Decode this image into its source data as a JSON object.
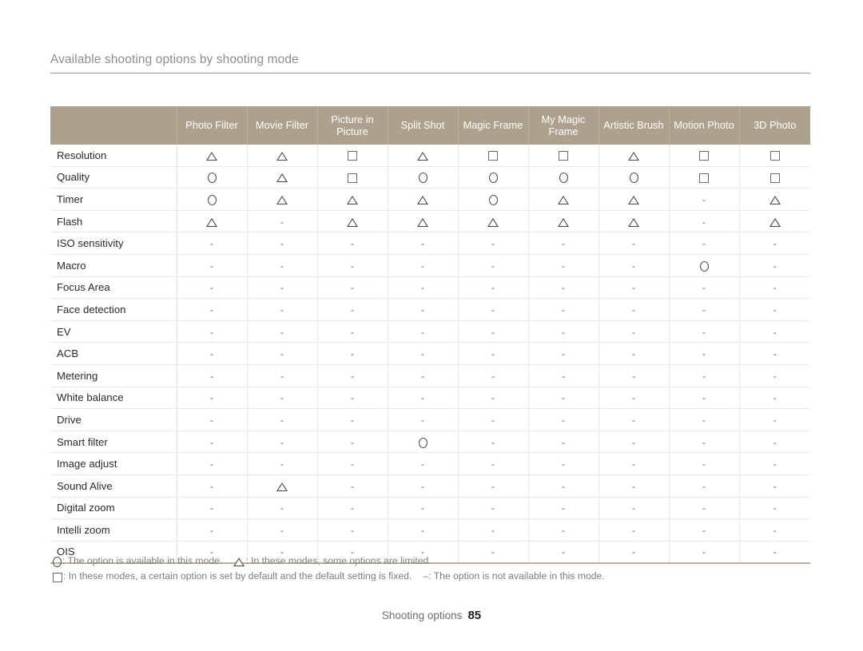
{
  "header": {
    "title": "Available shooting options by shooting mode"
  },
  "table": {
    "row_header_label": "",
    "columns": [
      "Photo Filter",
      "Movie Filter",
      "Picture in Picture",
      "Split Shot",
      "Magic Frame",
      "My Magic Frame",
      "Artistic Brush",
      "Motion Photo",
      "3D Photo"
    ],
    "rows": [
      {
        "name": "Resolution",
        "values": [
          "triangle",
          "triangle",
          "square",
          "triangle",
          "square",
          "square",
          "triangle",
          "square",
          "square"
        ]
      },
      {
        "name": "Quality",
        "values": [
          "circle",
          "triangle",
          "square",
          "circle",
          "circle",
          "circle",
          "circle",
          "square",
          "square"
        ]
      },
      {
        "name": "Timer",
        "values": [
          "circle",
          "triangle",
          "triangle",
          "triangle",
          "circle",
          "triangle",
          "triangle",
          "dash",
          "triangle"
        ]
      },
      {
        "name": "Flash",
        "values": [
          "triangle",
          "dash",
          "triangle",
          "triangle",
          "triangle",
          "triangle",
          "triangle",
          "dash",
          "triangle"
        ]
      },
      {
        "name": "ISO sensitivity",
        "values": [
          "dash",
          "dash",
          "dash",
          "dash",
          "dash",
          "dash",
          "dash",
          "dash",
          "dash"
        ]
      },
      {
        "name": "Macro",
        "values": [
          "dash",
          "dash",
          "dash",
          "dash",
          "dash",
          "dash",
          "dash",
          "circle",
          "dash"
        ]
      },
      {
        "name": "Focus Area",
        "values": [
          "dash",
          "dash",
          "dash",
          "dash",
          "dash",
          "dash",
          "dash",
          "dash",
          "dash"
        ]
      },
      {
        "name": "Face detection",
        "values": [
          "dash",
          "dash",
          "dash",
          "dash",
          "dash",
          "dash",
          "dash",
          "dash",
          "dash"
        ]
      },
      {
        "name": "EV",
        "values": [
          "dash",
          "dash",
          "dash",
          "dash",
          "dash",
          "dash",
          "dash",
          "dash",
          "dash"
        ]
      },
      {
        "name": "ACB",
        "values": [
          "dash",
          "dash",
          "dash",
          "dash",
          "dash",
          "dash",
          "dash",
          "dash",
          "dash"
        ]
      },
      {
        "name": "Metering",
        "values": [
          "dash",
          "dash",
          "dash",
          "dash",
          "dash",
          "dash",
          "dash",
          "dash",
          "dash"
        ]
      },
      {
        "name": "White balance",
        "values": [
          "dash",
          "dash",
          "dash",
          "dash",
          "dash",
          "dash",
          "dash",
          "dash",
          "dash"
        ]
      },
      {
        "name": "Drive",
        "values": [
          "dash",
          "dash",
          "dash",
          "dash",
          "dash",
          "dash",
          "dash",
          "dash",
          "dash"
        ]
      },
      {
        "name": "Smart filter",
        "values": [
          "dash",
          "dash",
          "dash",
          "circle",
          "dash",
          "dash",
          "dash",
          "dash",
          "dash"
        ]
      },
      {
        "name": "Image adjust",
        "values": [
          "dash",
          "dash",
          "dash",
          "dash",
          "dash",
          "dash",
          "dash",
          "dash",
          "dash"
        ]
      },
      {
        "name": "Sound Alive",
        "values": [
          "dash",
          "triangle",
          "dash",
          "dash",
          "dash",
          "dash",
          "dash",
          "dash",
          "dash"
        ]
      },
      {
        "name": "Digital zoom",
        "values": [
          "dash",
          "dash",
          "dash",
          "dash",
          "dash",
          "dash",
          "dash",
          "dash",
          "dash"
        ]
      },
      {
        "name": "Intelli zoom",
        "values": [
          "dash",
          "dash",
          "dash",
          "dash",
          "dash",
          "dash",
          "dash",
          "dash",
          "dash"
        ]
      },
      {
        "name": "OIS",
        "values": [
          "dash",
          "dash",
          "dash",
          "dash",
          "dash",
          "dash",
          "dash",
          "dash",
          "dash"
        ]
      }
    ]
  },
  "legend": {
    "circle_text": ": The option is available in this mode.",
    "triangle_text": ": In these modes, some options are limited.",
    "square_text": ": In these modes, a certain option is set by default and the default setting is fixed.",
    "dash_symbol": "–",
    "dash_text": ": The option is not available in this mode."
  },
  "footer": {
    "section": "Shooting options",
    "page_number": "85"
  },
  "colors": {
    "header_background": "#ada08c",
    "header_text": "#ffffff",
    "title_text": "#8e8e8e",
    "body_text": "#2f2f2f",
    "legend_text": "#7c7c7c"
  }
}
